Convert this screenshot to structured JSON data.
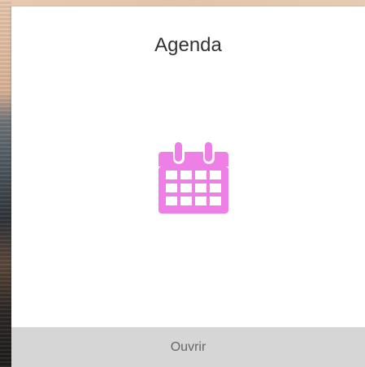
{
  "card": {
    "title": "Agenda",
    "icon": "calendar-icon",
    "action_label": "Ouvrir"
  },
  "colors": {
    "icon": "#ee7fe6",
    "footer_bg": "#d6d6d6",
    "card_bg": "#ffffff"
  }
}
